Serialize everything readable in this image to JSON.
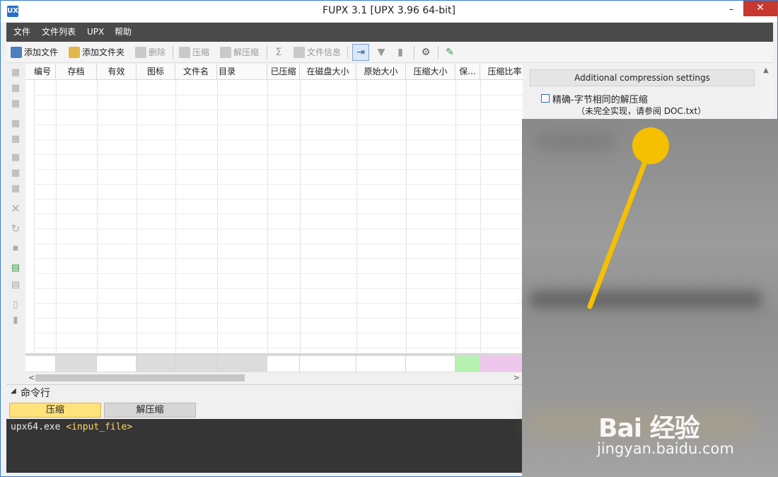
{
  "window": {
    "title": "FUPX 3.1   [UPX 3.96 64-bit]",
    "app_icon": "UX",
    "controls": {
      "minimize": "–",
      "maximize": "□",
      "close": "✕"
    }
  },
  "menu": [
    "文件",
    "文件列表",
    "UPX",
    "帮助"
  ],
  "toolbar": {
    "add_file": "添加文件",
    "add_folder": "添加文件夹",
    "delete": "删除",
    "compress": "压缩",
    "decompress": "解压缩",
    "file_info": "文件信息"
  },
  "grid": {
    "columns": [
      "编号",
      "存档",
      "有效",
      "图标",
      "文件名",
      "目录",
      "已压缩",
      "在磁盘大小",
      "原始大小",
      "压缩大小",
      "保...",
      "压缩比率"
    ],
    "summary_colors": {
      "keep": "#b7f2b0",
      "ratio": "#efc6ec"
    }
  },
  "panel": {
    "header": "Additional compression settings",
    "exact_label": "精确-字节相同的解压缩",
    "exact_note": "（未完全实现，请参阅 DOC.txt）"
  },
  "command": {
    "title": "命令行",
    "tab_compress": "压缩",
    "tab_decompress": "解压缩",
    "exe": "upx64.exe",
    "arg": "<input_file>"
  },
  "watermark": {
    "brand": "Bai 经验",
    "url": "jingyan.baidu.com"
  },
  "colors": {
    "menubar": "#4a4a4a",
    "active_tab": "#ffe27a",
    "console_bg": "#353535",
    "annotation": "#f5c000"
  }
}
